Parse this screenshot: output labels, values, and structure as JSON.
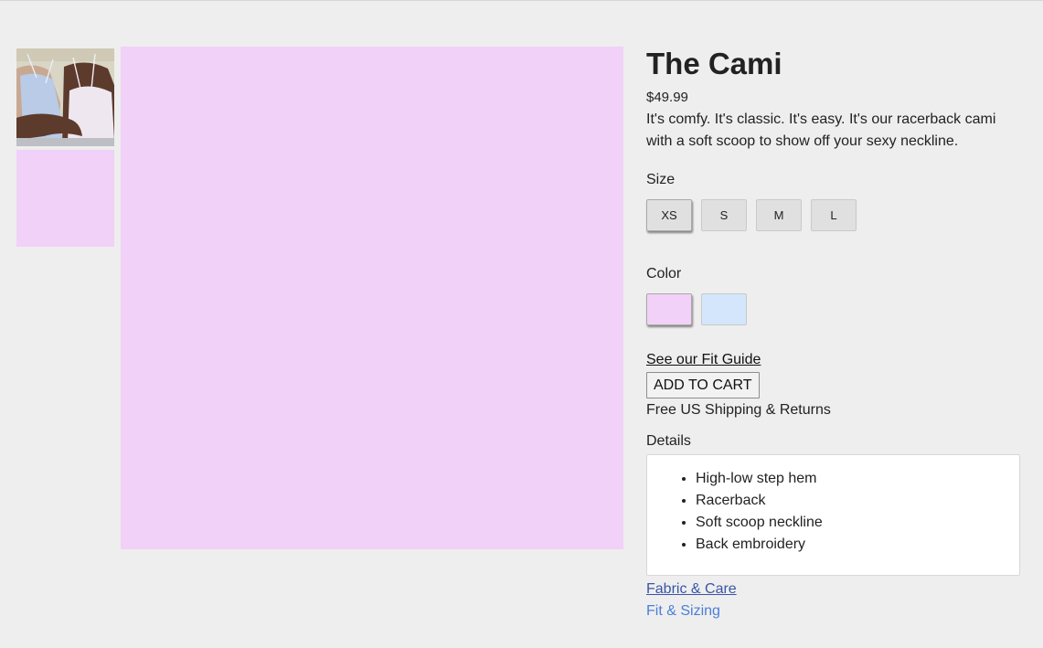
{
  "gallery": {
    "main_image_color": "#f1d1f7",
    "thumbnails": [
      {
        "kind": "photo",
        "name": "back-view-photo"
      },
      {
        "kind": "swatch",
        "color": "#f1d1f7"
      }
    ]
  },
  "product": {
    "title": "The Cami",
    "price": "$49.99",
    "description": "It's comfy. It's classic. It's easy. It's our racerback cami with a soft scoop to show off your sexy neckline."
  },
  "size": {
    "label": "Size",
    "options": [
      "XS",
      "S",
      "M",
      "L"
    ],
    "selected": "XS"
  },
  "color": {
    "label": "Color",
    "options": [
      {
        "name": "pink",
        "hex": "#f1d1f7"
      },
      {
        "name": "light-blue",
        "hex": "#d3e6fb"
      }
    ],
    "selected": "pink"
  },
  "actions": {
    "fit_guide_link": "See our Fit Guide",
    "add_to_cart": "ADD TO CART",
    "shipping_note": "Free US Shipping & Returns"
  },
  "details": {
    "label": "Details",
    "items": [
      "High-low step hem",
      "Racerback",
      "Soft scoop neckline",
      "Back embroidery"
    ]
  },
  "links": {
    "fabric_care": "Fabric & Care",
    "fit_sizing": "Fit & Sizing"
  }
}
